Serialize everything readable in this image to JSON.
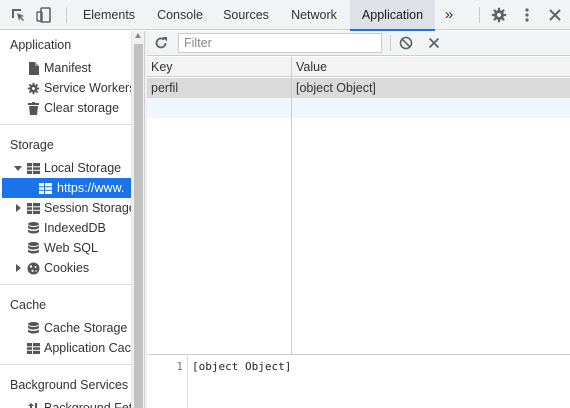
{
  "topbar": {
    "tabs": [
      "Elements",
      "Console",
      "Sources",
      "Network",
      "Application"
    ],
    "active_tab": "Application",
    "more_label": "»",
    "icons": [
      "inspect-icon",
      "device-toolbar-icon",
      "settings-icon",
      "more-vert-icon",
      "close-icon"
    ]
  },
  "sidebar": {
    "application": {
      "title": "Application",
      "items": [
        "Manifest",
        "Service Workers",
        "Clear storage"
      ]
    },
    "storage": {
      "title": "Storage",
      "local_storage": "Local Storage",
      "local_storage_origin": "https://www.",
      "items": [
        "Session Storage",
        "IndexedDB",
        "Web SQL",
        "Cookies"
      ]
    },
    "cache": {
      "title": "Cache",
      "items": [
        "Cache Storage",
        "Application Cac"
      ]
    },
    "background": {
      "title": "Background Services",
      "items": [
        "Background Fet"
      ]
    }
  },
  "toolbar": {
    "filter_placeholder": "Filter",
    "filter_value": ""
  },
  "grid": {
    "columns": [
      "Key",
      "Value"
    ],
    "rows": [
      {
        "key": "perfil",
        "value": "[object Object]"
      }
    ]
  },
  "preview": {
    "line_number": "1",
    "content": "[object Object]"
  },
  "colors": {
    "accent": "#1a73e8",
    "selected_row": "#dadada",
    "toolbar_bg": "#f1f3f4"
  }
}
